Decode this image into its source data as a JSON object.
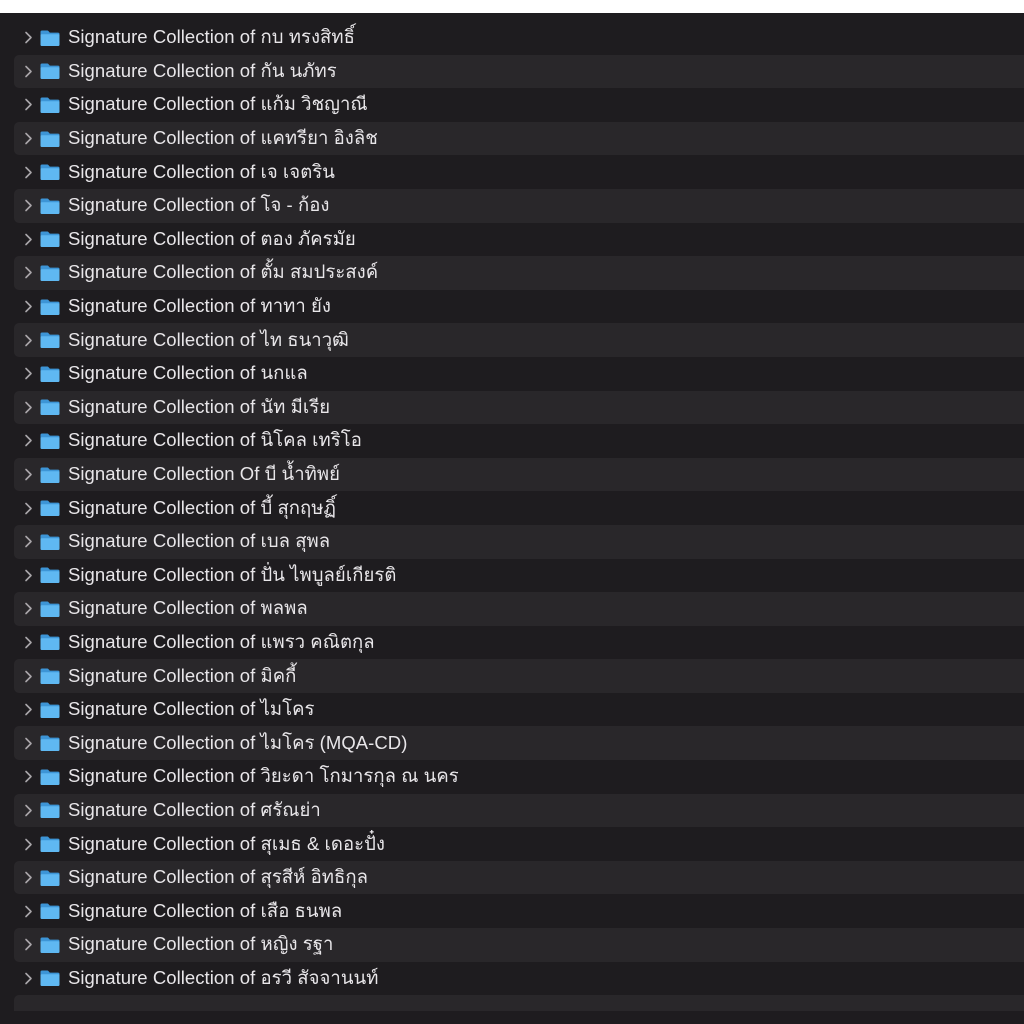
{
  "colors": {
    "background": "#1e1c1f",
    "row_stripe": "#29272a",
    "folder_blue": "#5fb8f2",
    "text": "#e8e6e9"
  },
  "row_icons": {
    "disclosure": "chevron-right-icon",
    "item": "folder-icon"
  },
  "folders": [
    "Signature Collection of กบ ทรงสิทธิ์",
    "Signature Collection of กัน นภัทร",
    "Signature Collection of แก้ม วิชญาณี",
    "Signature Collection of แคทรียา อิงลิช",
    "Signature Collection of เจ เจตริน",
    "Signature Collection of โจ - ก้อง",
    "Signature Collection of ตอง ภัครมัย",
    "Signature Collection of ตั้ม สมประสงค์",
    "Signature Collection of ทาทา ยัง",
    "Signature Collection of ไท ธนาวุฒิ",
    "Signature Collection of นกแล",
    "Signature Collection of นัท มีเรีย",
    "Signature Collection of นิโคล เทริโอ",
    "Signature Collection Of บี น้ำทิพย์",
    "Signature Collection of บี้ สุกฤษฏิ์",
    "Signature Collection of เบล สุพล",
    "Signature Collection of ปั่น ไพบูลย์เกียรติ",
    "Signature Collection of พลพล",
    "Signature Collection of แพรว คณิตกุล",
    "Signature Collection of มิคกี้",
    "Signature Collection of ไมโคร",
    "Signature Collection of ไมโคร (MQA-CD)",
    "Signature Collection of วิยะดา โกมารกุล ณ นคร",
    "Signature Collection of ศรัณย่า",
    "Signature Collection of สุเมธ & เดอะปั๋ง",
    "Signature Collection of สุรสีห์ อิทธิกุล",
    "Signature Collection of เสือ ธนพล",
    "Signature Collection of หญิง รฐา",
    "Signature Collection of อรวี สัจจานนท์"
  ]
}
